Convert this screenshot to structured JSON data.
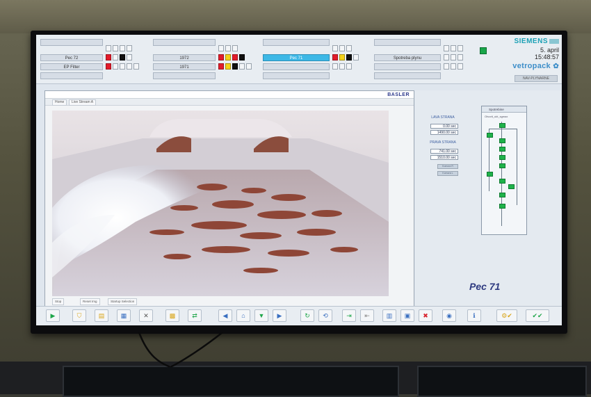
{
  "header": {
    "rows": [
      {
        "cells": [
          {
            "label": "",
            "active": false
          },
          {
            "label": "",
            "active": false
          },
          {
            "label": "",
            "active": false
          },
          {
            "label": "",
            "active": false
          }
        ]
      },
      {
        "cells": [
          {
            "label": "Pec 72",
            "active": false
          },
          {
            "label": "1972",
            "active": false
          },
          {
            "label": "Pec 71",
            "active": true
          },
          {
            "label": "Spotreba plynu",
            "active": false
          }
        ]
      },
      {
        "cells": [
          {
            "label": "EP Filter",
            "active": false
          },
          {
            "label": "1971",
            "active": false
          },
          {
            "label": "",
            "active": false
          },
          {
            "label": "",
            "active": false
          }
        ]
      }
    ],
    "brand": {
      "siemens": "SIEMENS",
      "date": "5. april",
      "time": "15:48:57",
      "logo": "vetropack"
    },
    "user": "NAV-PLYNARNE"
  },
  "window": {
    "brand": "BASLER",
    "tabs": [
      "Home",
      "Live Stream A"
    ],
    "footer_buttons": [
      "Stop",
      "Reset Img",
      "Startup Selection"
    ]
  },
  "right_panel": {
    "left_side": {
      "label": "LAVA STRANA",
      "value1": "0.00 sec",
      "value2": "1490.00 sec"
    },
    "right_side": {
      "label": "PRAVA STRANA",
      "value1": "741.00 sec",
      "value2": "1510.00 sec"
    },
    "chamber_labels": [
      "Komora R",
      "Komora L"
    ],
    "schematic_title": "Spotrebine",
    "schematic_sub": "Otvorit_ukt_sgmax",
    "furnace_label": "Pec 71"
  },
  "toolbar": {
    "icons": [
      "play-icon",
      "filter-icon",
      "folder-icon",
      "image-icon",
      "graph-icon",
      "grid-icon",
      "arrows-icon",
      "left-arrow-icon",
      "home-icon",
      "down-arrow-icon",
      "right-arrow-icon",
      "refresh-icon",
      "sync-icon",
      "import-icon",
      "export-icon",
      "document-icon",
      "save-icon",
      "delete-icon",
      "view-icon",
      "info-icon",
      "tools-icon",
      "check-icon"
    ]
  },
  "colors": {
    "accent_blue": "#3db8e6",
    "status_red": "#e21b2a",
    "status_yellow": "#f4d21a",
    "status_green": "#1fb24a",
    "brand_navy": "#2e3a80"
  }
}
